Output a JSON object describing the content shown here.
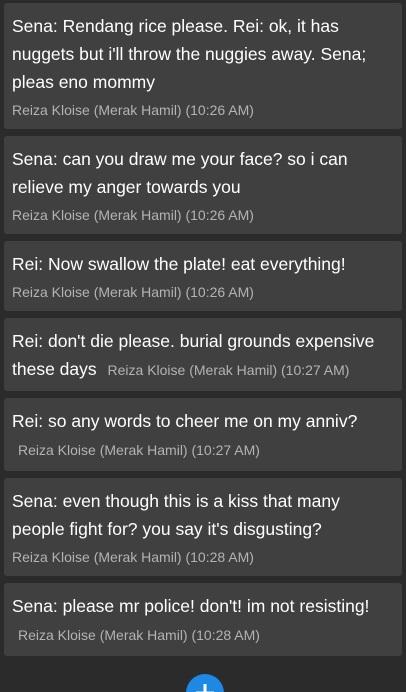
{
  "messages": [
    {
      "text": "Sena: Rendang rice please. Rei: ok, it has nuggets but i'll throw the nuggies away. Sena; pleas eno mommy",
      "meta": "Reiza Kloise (Merak Hamil) (10:26 AM)",
      "meta_inline": false
    },
    {
      "text": "Sena: can you draw me your face? so i can relieve my anger towards you",
      "meta": "Reiza Kloise (Merak Hamil) (10:26 AM)",
      "meta_inline": false
    },
    {
      "text": "Rei: Now swallow the plate! eat everything!",
      "meta": "Reiza Kloise (Merak Hamil) (10:26 AM)",
      "meta_inline": false
    },
    {
      "text": "Rei: don't die please. burial grounds expensive these days",
      "meta": "Reiza Kloise (Merak Hamil) (10:27 AM)",
      "meta_inline": true
    },
    {
      "text": "Rei: so any words to cheer me on my anniv?",
      "meta": "Reiza Kloise (Merak Hamil) (10:27 AM)",
      "meta_inline": true
    },
    {
      "text": "Sena: even though this is a kiss that many people fight for? you say it's disgusting?",
      "meta": "Reiza Kloise (Merak Hamil) (10:28 AM)",
      "meta_inline": false
    },
    {
      "text": "Sena: please mr police! don't! im not resisting!",
      "meta": "Reiza Kloise (Merak Hamil) (10:28 AM)",
      "meta_inline": true
    }
  ],
  "fab": {
    "icon": "plus-icon",
    "color": "#1e88e5"
  },
  "colors": {
    "background": "#2b2b2b",
    "card": "#404040",
    "text": "#ffffff",
    "meta": "#b3b3b3"
  }
}
